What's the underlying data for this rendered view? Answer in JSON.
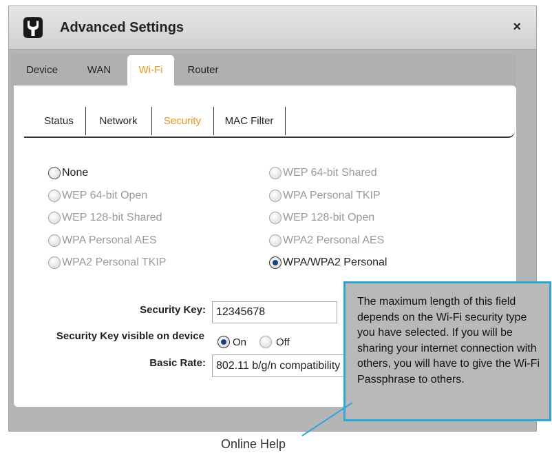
{
  "dialog": {
    "title": "Advanced Settings",
    "close_label": "×",
    "icon": "wrench-icon"
  },
  "top_tabs": [
    {
      "label": "Device",
      "active": false
    },
    {
      "label": "WAN",
      "active": false
    },
    {
      "label": "Wi-Fi",
      "active": true
    },
    {
      "label": "Router",
      "active": false
    }
  ],
  "sub_tabs": [
    {
      "label": "Status",
      "active": false
    },
    {
      "label": "Network",
      "active": false
    },
    {
      "label": "Security",
      "active": true
    },
    {
      "label": "MAC Filter",
      "active": false
    }
  ],
  "security_modes": {
    "left": [
      {
        "label": "None",
        "enabled": true,
        "checked": false
      },
      {
        "label": "WEP 64-bit Open",
        "enabled": false,
        "checked": false
      },
      {
        "label": "WEP 128-bit Shared",
        "enabled": false,
        "checked": false
      },
      {
        "label": "WPA Personal AES",
        "enabled": false,
        "checked": false
      },
      {
        "label": "WPA2 Personal TKIP",
        "enabled": false,
        "checked": false
      }
    ],
    "right": [
      {
        "label": "WEP 64-bit Shared",
        "enabled": false,
        "checked": false
      },
      {
        "label": "WPA Personal TKIP",
        "enabled": false,
        "checked": false
      },
      {
        "label": "WEP 128-bit Open",
        "enabled": false,
        "checked": false
      },
      {
        "label": "WPA2 Personal AES",
        "enabled": false,
        "checked": false
      },
      {
        "label": "WPA/WPA2 Personal",
        "enabled": true,
        "checked": true
      }
    ]
  },
  "fields": {
    "security_key_label": "Security Key:",
    "security_key_value": "12345678",
    "visible_label": "Security Key visible on device",
    "visible_on_label": "On",
    "visible_off_label": "Off",
    "basic_rate_label": "Basic Rate:",
    "basic_rate_value": "802.11 b/g/n compatibility"
  },
  "tooltip": {
    "text": "The maximum length of this field depends on the Wi-Fi security type you have selected. If you will be sharing your internet connection with others, you will have to give the Wi-Fi Passphrase to others."
  },
  "callout": {
    "label": "Online Help"
  },
  "colors": {
    "accent": "#f0921e",
    "tooltip_border": "#2ea6d9",
    "radio_selected": "#1b3f86"
  }
}
